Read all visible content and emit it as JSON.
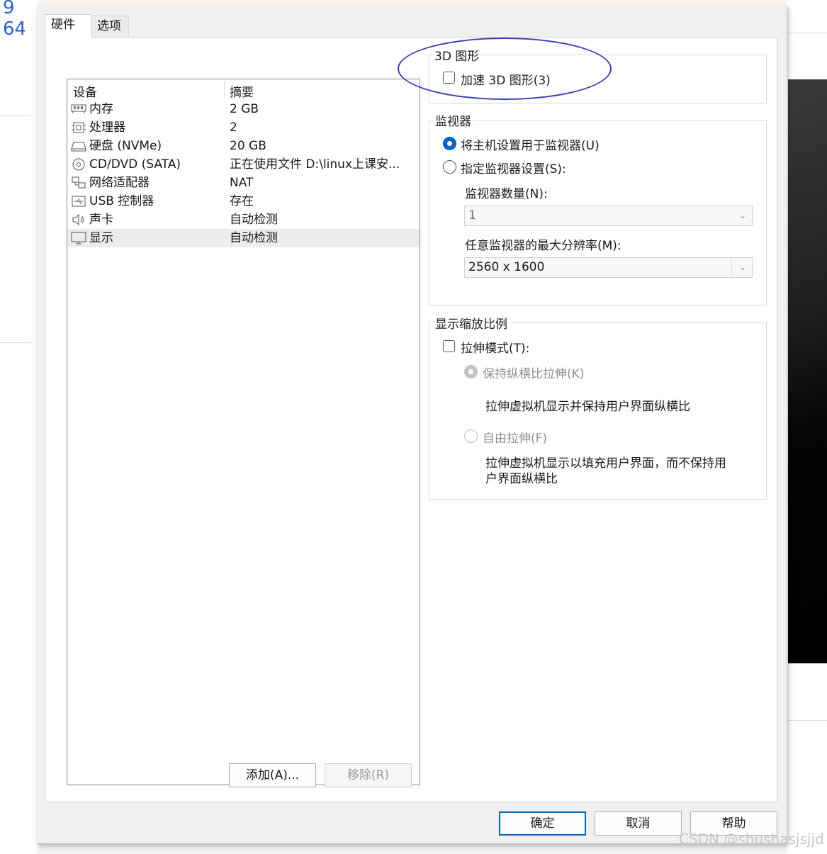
{
  "background": {
    "left_text": "9 64",
    "watermark": "CSDN @shushasjsjjd"
  },
  "tabs": [
    {
      "label": "硬件"
    },
    {
      "label": "选项"
    }
  ],
  "device_list": {
    "header_device": "设备",
    "header_summary": "摘要",
    "rows": [
      {
        "icon": "memory-icon",
        "name": "内存",
        "summary": "2 GB"
      },
      {
        "icon": "processor-icon",
        "name": "处理器",
        "summary": "2"
      },
      {
        "icon": "hard-disk-icon",
        "name": "硬盘 (NVMe)",
        "summary": "20 GB"
      },
      {
        "icon": "cd-dvd-icon",
        "name": "CD/DVD (SATA)",
        "summary": "正在使用文件 D:\\linux上课安..."
      },
      {
        "icon": "network-adapter-icon",
        "name": "网络适配器",
        "summary": "NAT"
      },
      {
        "icon": "usb-icon",
        "name": "USB 控制器",
        "summary": "存在"
      },
      {
        "icon": "sound-icon",
        "name": "声卡",
        "summary": "自动检测"
      },
      {
        "icon": "display-icon",
        "name": "显示",
        "summary": "自动检测"
      }
    ],
    "selected_index": 7
  },
  "buttons": {
    "add": "添加(A)...",
    "remove": "移除(R)",
    "ok": "确定",
    "cancel": "取消",
    "help": "帮助"
  },
  "graphics_3d": {
    "title": "3D 图形",
    "accelerate_label": "加速 3D 图形(3)",
    "accelerate_checked": false
  },
  "monitor": {
    "title": "监视器",
    "use_host_label": "将主机设置用于监视器(U)",
    "specify_label": "指定监视器设置(S):",
    "use_host_selected": true,
    "count_label": "监视器数量(N):",
    "count_value": "1",
    "max_res_label": "任意监视器的最大分辨率(M):",
    "max_res_value": "2560 x 1600"
  },
  "scaling": {
    "title": "显示缩放比例",
    "stretch_label": "拉伸模式(T):",
    "stretch_checked": false,
    "keep_aspect_label": "保持纵横比拉伸(K)",
    "keep_aspect_desc": "拉伸虚拟机显示并保持用户界面纵横比",
    "free_label": "自由拉伸(F)",
    "free_desc_line1": "拉伸虚拟机显示以填充用户界面，而不保持用",
    "free_desc_line2": "户界面纵横比"
  },
  "colors": {
    "accent": "#0067c0",
    "annotation": "#3b3bb8"
  }
}
